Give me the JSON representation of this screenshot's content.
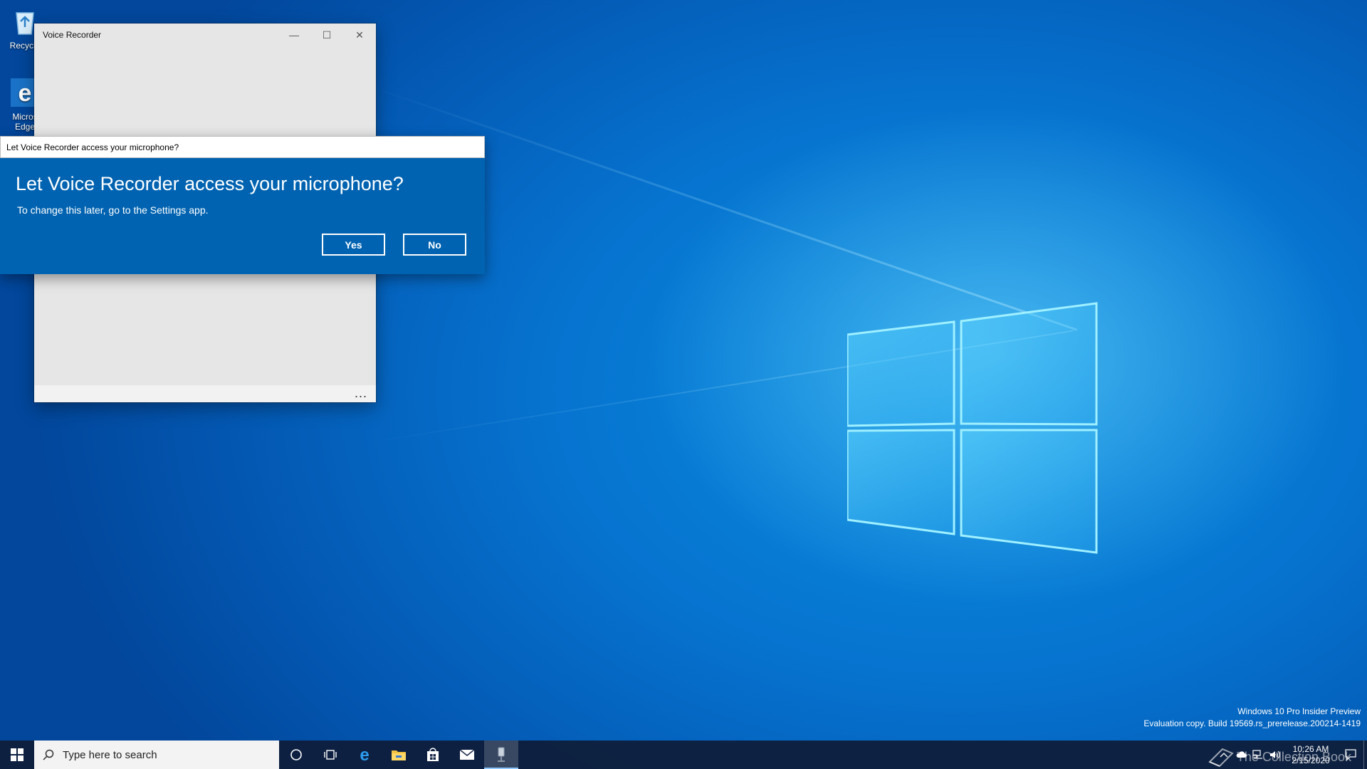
{
  "desktop": {
    "icons": [
      {
        "label": "Recycle",
        "icon": "recycle-bin-icon"
      },
      {
        "label": "Micros Edge",
        "icon": "edge-icon"
      }
    ]
  },
  "voice_recorder": {
    "title": "Voice Recorder",
    "minimize_glyph": "—",
    "maximize_glyph": "☐",
    "close_glyph": "✕",
    "more_glyph": "..."
  },
  "dialog": {
    "titlebar": "Let Voice Recorder access your microphone?",
    "heading": "Let Voice Recorder access your microphone?",
    "subtext": "To change this later, go to the Settings app.",
    "yes_label": "Yes",
    "no_label": "No",
    "background_color": "#0063b1"
  },
  "watermark": {
    "line1": "Windows 10 Pro Insider Preview",
    "line2": "Evaluation copy. Build 19569.rs_prerelease.200214-1419"
  },
  "taskbar": {
    "search_placeholder": "Type here to search",
    "pinned": [
      "cortana-icon",
      "task-view-icon",
      "edge-icon",
      "file-explorer-icon",
      "store-icon",
      "mail-icon",
      "voice-recorder-icon"
    ],
    "clock_time": "10:26 AM",
    "clock_date": "2/15/2020",
    "brand_text": "The Collection Book"
  }
}
